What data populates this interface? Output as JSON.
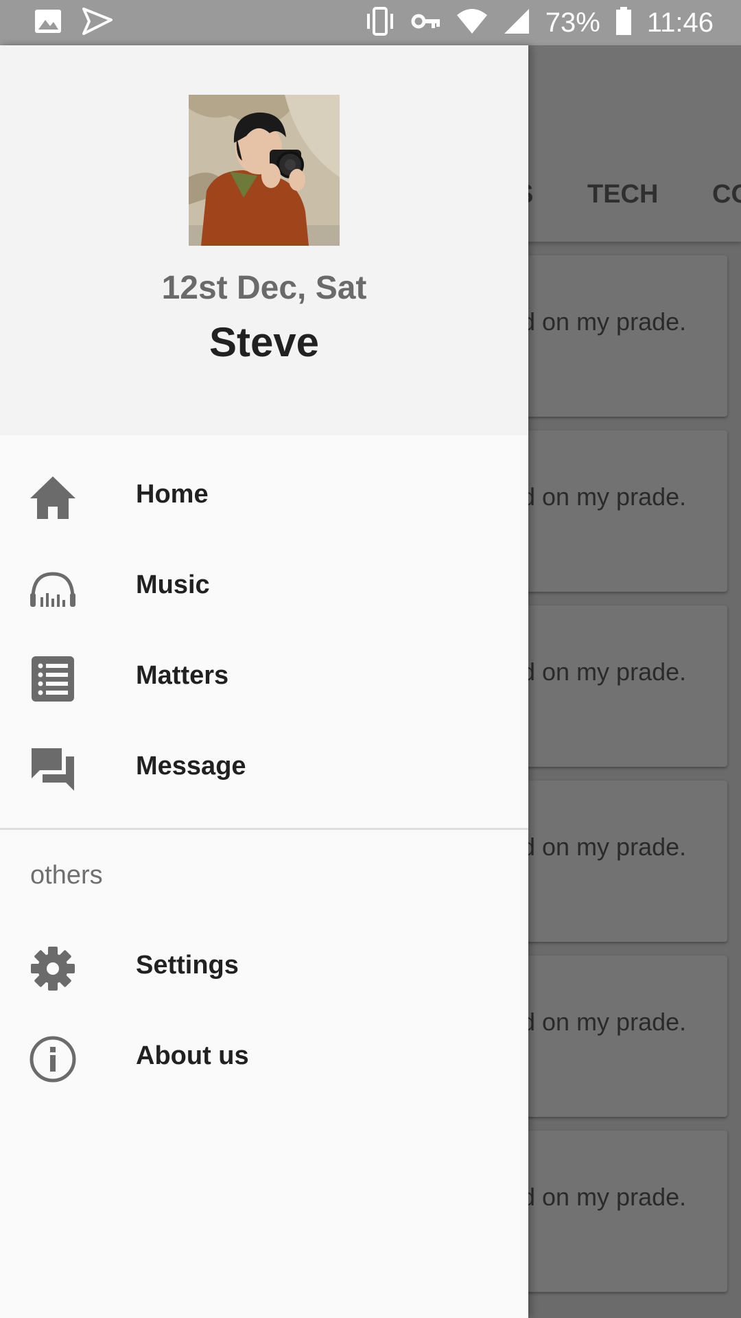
{
  "status_bar": {
    "time": "11:46",
    "battery": "73%",
    "icons_left": [
      "image-icon",
      "send-icon"
    ],
    "icons_right": [
      "vibrate-icon",
      "vpn-key-icon",
      "wifi-icon",
      "signal-icon",
      "battery-icon"
    ]
  },
  "background": {
    "tabs": [
      "S",
      "TECH",
      "CO"
    ],
    "card_text": "d on my prade."
  },
  "drawer": {
    "header": {
      "date": "12st Dec, Sat",
      "name": "Steve"
    },
    "nav_items": [
      {
        "label": "Home",
        "icon": "home-icon"
      },
      {
        "label": "Music",
        "icon": "headphones-icon"
      },
      {
        "label": "Matters",
        "icon": "list-icon"
      },
      {
        "label": "Message",
        "icon": "forum-icon"
      }
    ],
    "section_title": "others",
    "other_items": [
      {
        "label": "Settings",
        "icon": "gear-icon"
      },
      {
        "label": "About us",
        "icon": "info-icon"
      }
    ]
  },
  "colors": {
    "drawer_bg": "#fafafa",
    "header_bg": "#f3f3f3",
    "icon": "#6b6b6b",
    "scrim": "#6b6b6b"
  }
}
